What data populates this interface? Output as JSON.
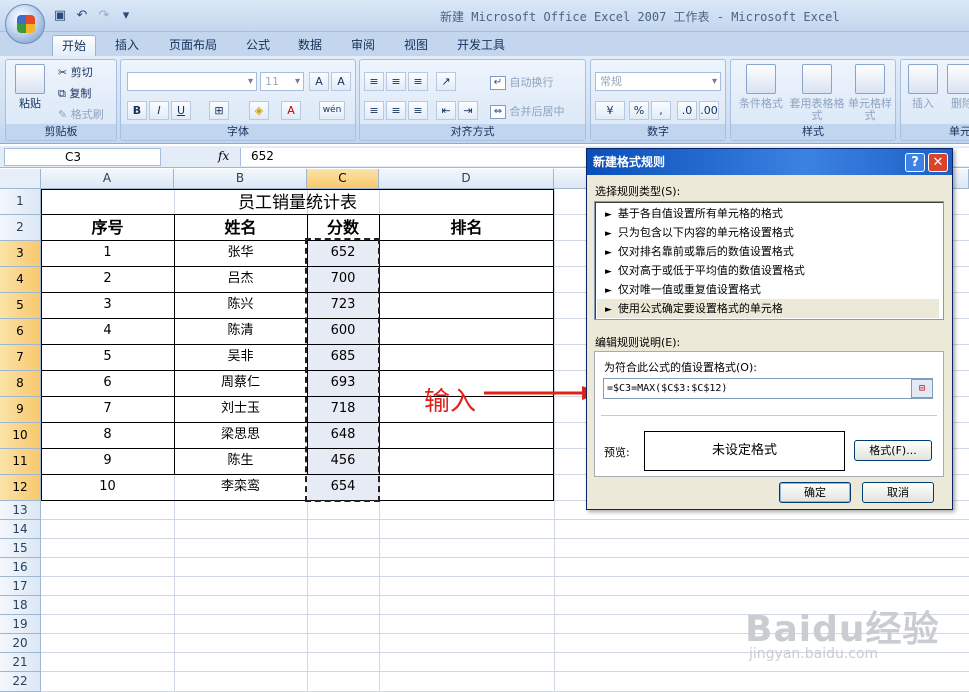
{
  "window": {
    "title": "新建 Microsoft Office Excel 2007 工作表 - Microsoft Excel"
  },
  "ribbon": {
    "tabs": [
      "开始",
      "插入",
      "页面布局",
      "公式",
      "数据",
      "审阅",
      "视图",
      "开发工具"
    ],
    "clipboard": {
      "label": "剪贴板",
      "paste": "粘贴",
      "cut": "剪切",
      "copy": "复制",
      "format_painter": "格式刷"
    },
    "font": {
      "label": "字体",
      "size": "11"
    },
    "alignment": {
      "label": "对齐方式",
      "wrap": "自动换行",
      "merge": "合并后居中"
    },
    "number": {
      "label": "数字",
      "format": "常规"
    },
    "styles": {
      "label": "样式",
      "conditional": "条件格式",
      "table": "套用表格格式",
      "cell": "单元格样式"
    },
    "cells": {
      "label": "单元",
      "insert": "插入",
      "delete": "删除"
    }
  },
  "formula_bar": {
    "name_box": "C3",
    "fx": "fx",
    "value": "652"
  },
  "sheet": {
    "columns": [
      "A",
      "B",
      "C",
      "D"
    ],
    "rows": [
      "1",
      "2",
      "3",
      "4",
      "5",
      "6",
      "7",
      "8",
      "9",
      "10",
      "11",
      "12",
      "13",
      "14",
      "15",
      "16",
      "17",
      "18",
      "19",
      "20",
      "21",
      "22"
    ],
    "title": "员工销量统计表",
    "headers": [
      "序号",
      "姓名",
      "分数",
      "排名"
    ],
    "data": [
      [
        "1",
        "张华",
        "652"
      ],
      [
        "2",
        "吕杰",
        "700"
      ],
      [
        "3",
        "陈兴",
        "723"
      ],
      [
        "4",
        "陈清",
        "600"
      ],
      [
        "5",
        "吴非",
        "685"
      ],
      [
        "6",
        "周蔡仁",
        "693"
      ],
      [
        "7",
        "刘士玉",
        "718"
      ],
      [
        "8",
        "梁思思",
        "648"
      ],
      [
        "9",
        "陈生",
        "456"
      ],
      [
        "10",
        "李栾鸾",
        "654"
      ]
    ]
  },
  "annotation": {
    "text": "输入",
    "color": "#e0231a"
  },
  "dialog": {
    "title": "新建格式规则",
    "select_label": "选择规则类型(S):",
    "rules": [
      "基于各自值设置所有单元格的格式",
      "只为包含以下内容的单元格设置格式",
      "仅对排名靠前或靠后的数值设置格式",
      "仅对高于或低于平均值的数值设置格式",
      "仅对唯一值或重复值设置格式",
      "使用公式确定要设置格式的单元格"
    ],
    "edit_label": "编辑规则说明(E):",
    "formula_label": "为符合此公式的值设置格式(O):",
    "formula": "=$C3=MAX($C$3:$C$12)",
    "preview_label": "预览:",
    "preview_text": "未设定格式",
    "format_button": "格式(F)...",
    "ok": "确定",
    "cancel": "取消"
  },
  "watermark": {
    "text": "Baidu经验",
    "sub": "jingyan.baidu.com"
  }
}
